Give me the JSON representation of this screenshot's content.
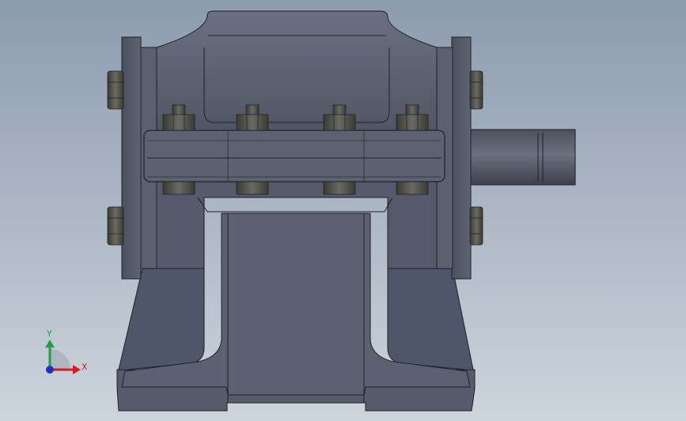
{
  "viewport": {
    "background_top": "#8c9bae",
    "background_bottom": "#cdd4dc"
  },
  "model": {
    "body_color": "#565c6b",
    "edge_color": "#1e2028",
    "bolt_color": "#4a4a44"
  },
  "triad": {
    "x_label": "X",
    "y_label": "Y",
    "x_color": "#d42020",
    "y_color": "#20a040",
    "z_color": "#2030c0"
  }
}
